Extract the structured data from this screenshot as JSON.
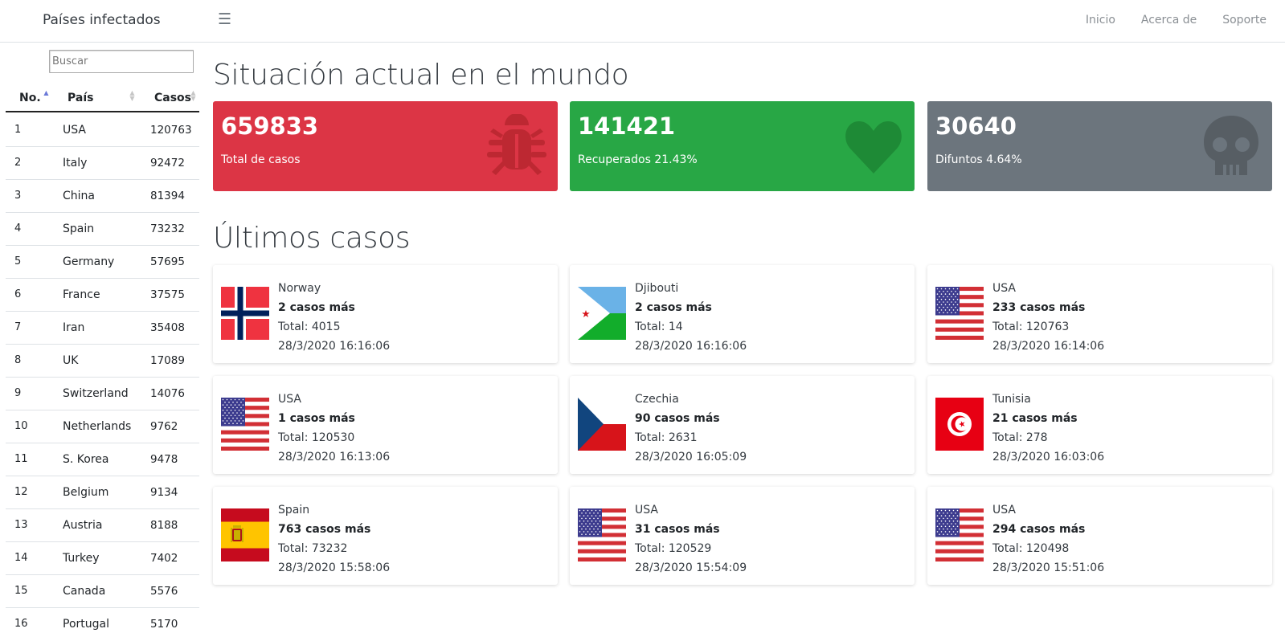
{
  "navbar": {
    "brand": "Países infectados",
    "menu_icon": "hamburger-icon",
    "links": [
      "Inicio",
      "Acerca de",
      "Soporte"
    ]
  },
  "sidebar": {
    "search_placeholder": "Buscar",
    "columns": [
      "No.",
      "País",
      "Casos"
    ],
    "sort": {
      "column": "No.",
      "direction": "asc"
    },
    "rows": [
      {
        "no": "1",
        "pais": "USA",
        "casos": "120763"
      },
      {
        "no": "2",
        "pais": "Italy",
        "casos": "92472"
      },
      {
        "no": "3",
        "pais": "China",
        "casos": "81394"
      },
      {
        "no": "4",
        "pais": "Spain",
        "casos": "73232"
      },
      {
        "no": "5",
        "pais": "Germany",
        "casos": "57695"
      },
      {
        "no": "6",
        "pais": "France",
        "casos": "37575"
      },
      {
        "no": "7",
        "pais": "Iran",
        "casos": "35408"
      },
      {
        "no": "8",
        "pais": "UK",
        "casos": "17089"
      },
      {
        "no": "9",
        "pais": "Switzerland",
        "casos": "14076"
      },
      {
        "no": "10",
        "pais": "Netherlands",
        "casos": "9762"
      },
      {
        "no": "11",
        "pais": "S. Korea",
        "casos": "9478"
      },
      {
        "no": "12",
        "pais": "Belgium",
        "casos": "9134"
      },
      {
        "no": "13",
        "pais": "Austria",
        "casos": "8188"
      },
      {
        "no": "14",
        "pais": "Turkey",
        "casos": "7402"
      },
      {
        "no": "15",
        "pais": "Canada",
        "casos": "5576"
      },
      {
        "no": "16",
        "pais": "Portugal",
        "casos": "5170"
      }
    ]
  },
  "main": {
    "title": "Situación actual en el mundo",
    "stats": [
      {
        "value": "659833",
        "label": "Total de casos",
        "color": "#dc3545",
        "icon": "bug-icon"
      },
      {
        "value": "141421",
        "label": "Recuperados 21.43%",
        "color": "#28a745",
        "icon": "heart-icon"
      },
      {
        "value": "30640",
        "label": "Difuntos 4.64%",
        "color": "#6c757d",
        "icon": "skull-icon"
      }
    ],
    "latest_title": "Últimos casos",
    "latest": [
      {
        "country": "Norway",
        "cases": "2 casos más",
        "total": "Total: 4015",
        "time": "28/3/2020 16:16:06",
        "flag": "norway-flag-icon"
      },
      {
        "country": "Djibouti",
        "cases": "2 casos más",
        "total": "Total: 14",
        "time": "28/3/2020 16:16:06",
        "flag": "djibouti-flag-icon"
      },
      {
        "country": "USA",
        "cases": "233 casos más",
        "total": "Total: 120763",
        "time": "28/3/2020 16:14:06",
        "flag": "usa-flag-icon"
      },
      {
        "country": "USA",
        "cases": "1 casos más",
        "total": "Total: 120530",
        "time": "28/3/2020 16:13:06",
        "flag": "usa-flag-icon"
      },
      {
        "country": "Czechia",
        "cases": "90 casos más",
        "total": "Total: 2631",
        "time": "28/3/2020 16:05:09",
        "flag": "czechia-flag-icon"
      },
      {
        "country": "Tunisia",
        "cases": "21 casos más",
        "total": "Total: 278",
        "time": "28/3/2020 16:03:06",
        "flag": "tunisia-flag-icon"
      },
      {
        "country": "Spain",
        "cases": "763 casos más",
        "total": "Total: 73232",
        "time": "28/3/2020 15:58:06",
        "flag": "spain-flag-icon"
      },
      {
        "country": "USA",
        "cases": "31 casos más",
        "total": "Total: 120529",
        "time": "28/3/2020 15:54:09",
        "flag": "usa-flag-icon"
      },
      {
        "country": "USA",
        "cases": "294 casos más",
        "total": "Total: 120498",
        "time": "28/3/2020 15:51:06",
        "flag": "usa-flag-icon"
      }
    ]
  }
}
